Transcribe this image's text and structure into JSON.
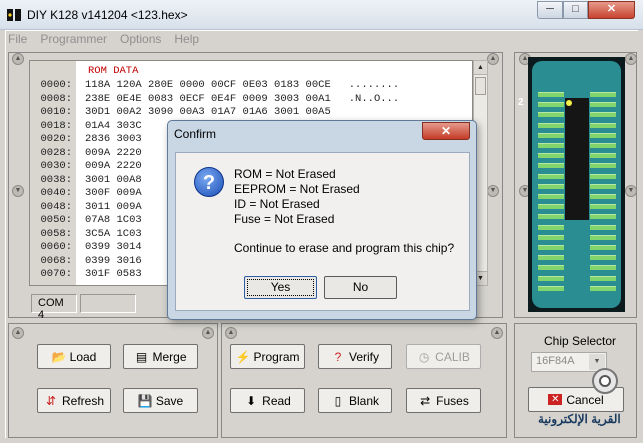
{
  "window": {
    "title": "DIY K128  v141204   <123.hex>",
    "minimize": "─",
    "maximize": "□",
    "close": "✕"
  },
  "menu": [
    "File",
    "Programmer",
    "Options",
    "Help"
  ],
  "hex": {
    "title": "ROM DATA",
    "lines": [
      {
        "addr": "0000:",
        "data": "118A 120A 280E 0000 00CF 0E03 0183 00CE",
        "ascii": "........"
      },
      {
        "addr": "0008:",
        "data": "238E 0E4E 0083 0ECF 0E4F 0009 3003 00A1",
        "ascii": ".N..O..."
      },
      {
        "addr": "0010:",
        "data": "30D1 00A2 3090 00A3 01A7 01A6 3001 00A5",
        "ascii": ""
      },
      {
        "addr": "0018:",
        "data": "01A4 303C",
        "ascii": ""
      },
      {
        "addr": "0020:",
        "data": "2836 3003",
        "ascii": ""
      },
      {
        "addr": "0028:",
        "data": "009A 2220",
        "ascii": ""
      },
      {
        "addr": "0030:",
        "data": "009A 2220",
        "ascii": ""
      },
      {
        "addr": "0038:",
        "data": "3001 00A8",
        "ascii": ""
      },
      {
        "addr": "0040:",
        "data": "300F 009A",
        "ascii": ""
      },
      {
        "addr": "0048:",
        "data": "3011 009A",
        "ascii": ""
      },
      {
        "addr": "0050:",
        "data": "07A8 1C03",
        "ascii": ""
      },
      {
        "addr": "0058:",
        "data": "3C5A 1C03",
        "ascii": ""
      },
      {
        "addr": "0060:",
        "data": "0399 3014",
        "ascii": ""
      },
      {
        "addr": "0068:",
        "data": "0399 3016",
        "ascii": ""
      },
      {
        "addr": "0070:",
        "data": "301F 0583",
        "ascii": ""
      }
    ]
  },
  "status": {
    "port": "COM  4"
  },
  "chip": {
    "pin_label": "2",
    "selector_label": "Chip Selector",
    "selected": "16F84A"
  },
  "buttons": {
    "load": "Load",
    "merge": "Merge",
    "refresh": "Refresh",
    "save": "Save",
    "program": "Program",
    "verify": "Verify",
    "calib": "CALIB",
    "read": "Read",
    "blank": "Blank",
    "fuses": "Fuses",
    "cancel": "Cancel"
  },
  "dialog": {
    "title": "Confirm",
    "close": "✕",
    "icon": "?",
    "lines": [
      "ROM = Not Erased",
      "EEPROM = Not Erased",
      "ID = Not Erased",
      "Fuse = Not Erased"
    ],
    "question": "Continue to erase and program this chip?",
    "yes": "Yes",
    "no": "No"
  },
  "watermark": "القرية الإلكترونية",
  "colors": {
    "rom_title": "#c00000",
    "socket": "#2a8d92",
    "pin": "#82d46c",
    "pin1": "#f3ef48",
    "close_btn": "#c53b27"
  }
}
